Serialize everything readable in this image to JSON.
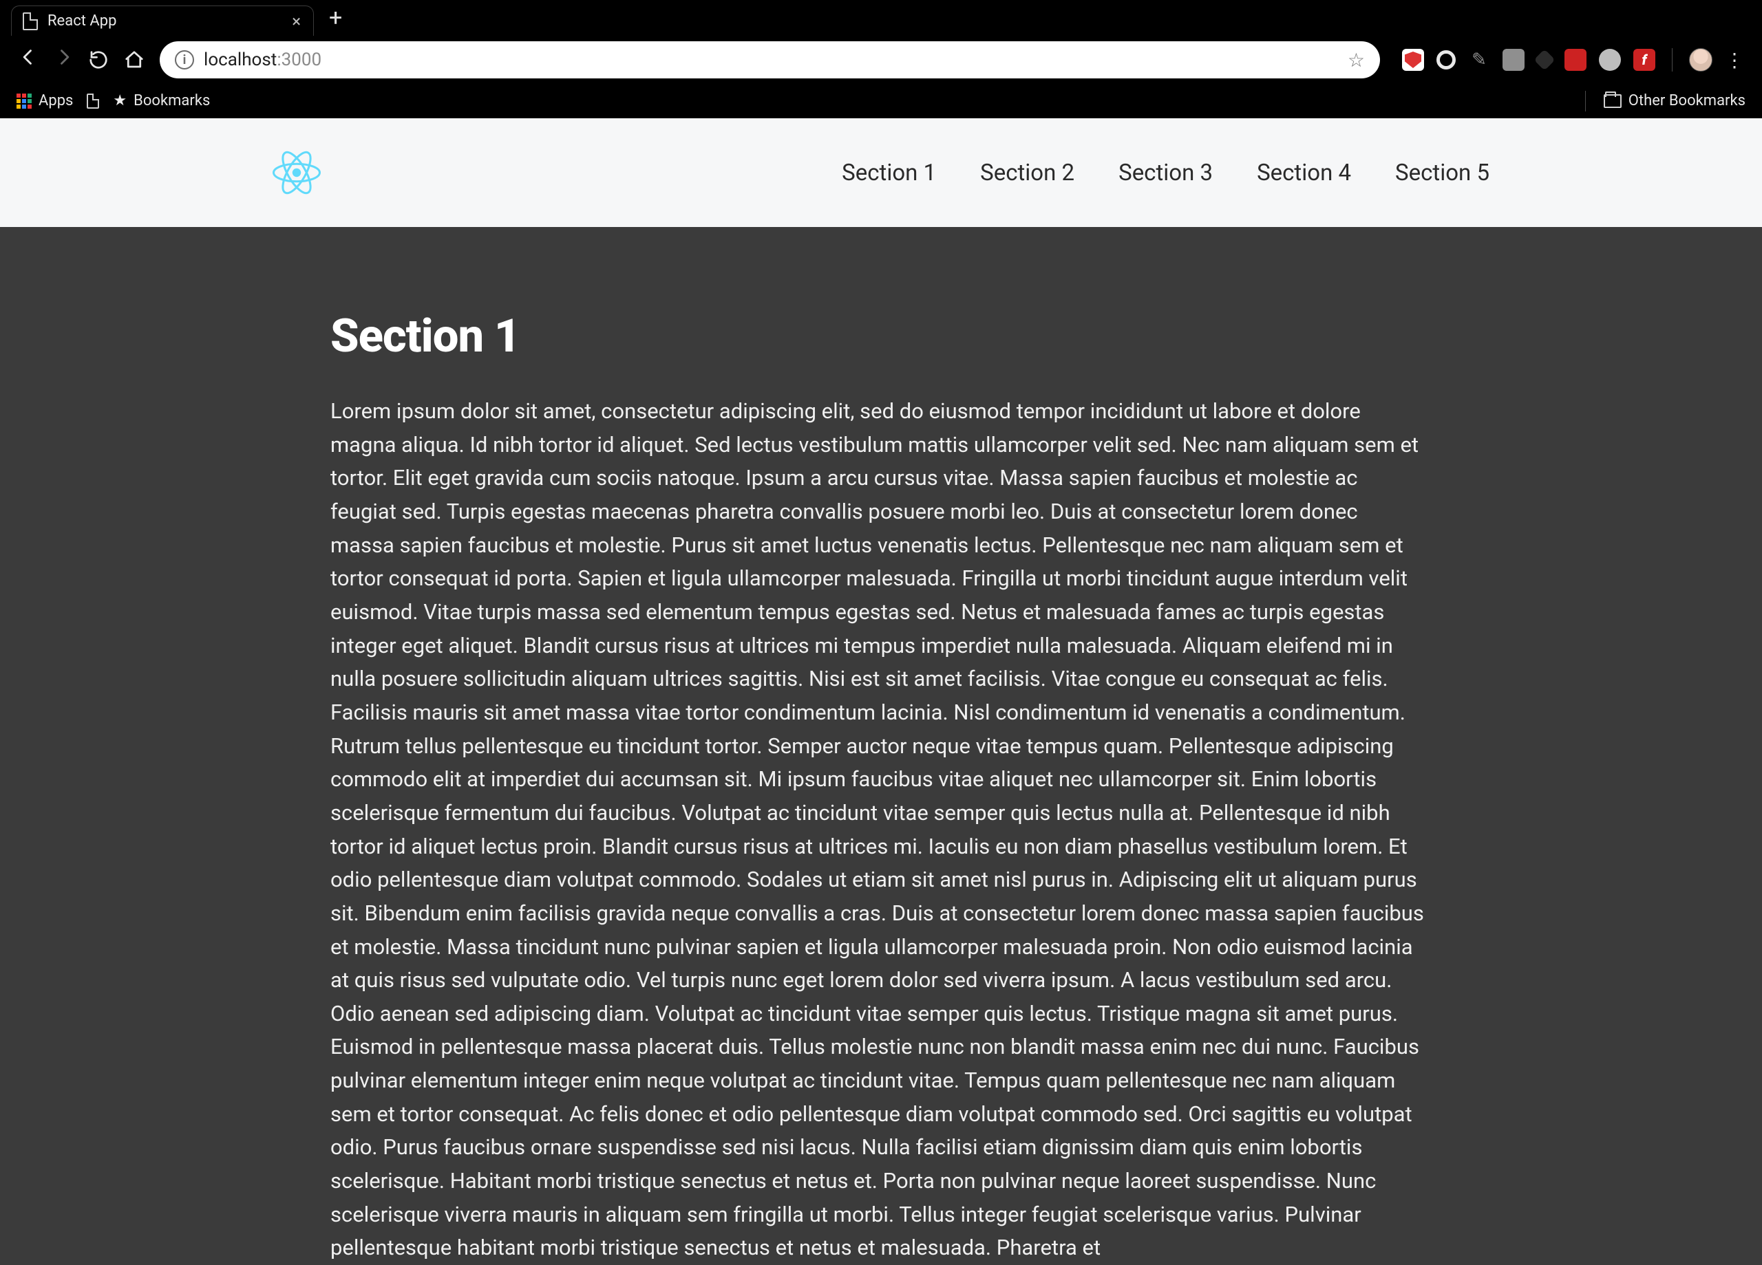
{
  "browser": {
    "tab_title": "React App",
    "url_host": "localhost",
    "url_port": ":3000",
    "apps_label": "Apps",
    "bookmarks_label": "Bookmarks",
    "other_bookmarks_label": "Other Bookmarks"
  },
  "nav": {
    "items": [
      {
        "label": "Section 1"
      },
      {
        "label": "Section 2"
      },
      {
        "label": "Section 3"
      },
      {
        "label": "Section 4"
      },
      {
        "label": "Section 5"
      }
    ]
  },
  "section": {
    "heading": "Section 1",
    "body": "Lorem ipsum dolor sit amet, consectetur adipiscing elit, sed do eiusmod tempor incididunt ut labore et dolore magna aliqua. Id nibh tortor id aliquet. Sed lectus vestibulum mattis ullamcorper velit sed. Nec nam aliquam sem et tortor. Elit eget gravida cum sociis natoque. Ipsum a arcu cursus vitae. Massa sapien faucibus et molestie ac feugiat sed. Turpis egestas maecenas pharetra convallis posuere morbi leo. Duis at consectetur lorem donec massa sapien faucibus et molestie. Purus sit amet luctus venenatis lectus. Pellentesque nec nam aliquam sem et tortor consequat id porta. Sapien et ligula ullamcorper malesuada. Fringilla ut morbi tincidunt augue interdum velit euismod. Vitae turpis massa sed elementum tempus egestas sed. Netus et malesuada fames ac turpis egestas integer eget aliquet. Blandit cursus risus at ultrices mi tempus imperdiet nulla malesuada. Aliquam eleifend mi in nulla posuere sollicitudin aliquam ultrices sagittis. Nisi est sit amet facilisis. Vitae congue eu consequat ac felis. Facilisis mauris sit amet massa vitae tortor condimentum lacinia. Nisl condimentum id venenatis a condimentum. Rutrum tellus pellentesque eu tincidunt tortor. Semper auctor neque vitae tempus quam. Pellentesque adipiscing commodo elit at imperdiet dui accumsan sit. Mi ipsum faucibus vitae aliquet nec ullamcorper sit. Enim lobortis scelerisque fermentum dui faucibus. Volutpat ac tincidunt vitae semper quis lectus nulla at. Pellentesque id nibh tortor id aliquet lectus proin. Blandit cursus risus at ultrices mi. Iaculis eu non diam phasellus vestibulum lorem. Et odio pellentesque diam volutpat commodo. Sodales ut etiam sit amet nisl purus in. Adipiscing elit ut aliquam purus sit. Bibendum enim facilisis gravida neque convallis a cras. Duis at consectetur lorem donec massa sapien faucibus et molestie. Massa tincidunt nunc pulvinar sapien et ligula ullamcorper malesuada proin. Non odio euismod lacinia at quis risus sed vulputate odio. Vel turpis nunc eget lorem dolor sed viverra ipsum. A lacus vestibulum sed arcu. Odio aenean sed adipiscing diam. Volutpat ac tincidunt vitae semper quis lectus. Tristique magna sit amet purus. Euismod in pellentesque massa placerat duis. Tellus molestie nunc non blandit massa enim nec dui nunc. Faucibus pulvinar elementum integer enim neque volutpat ac tincidunt vitae. Tempus quam pellentesque nec nam aliquam sem et tortor consequat. Ac felis donec et odio pellentesque diam volutpat commodo sed. Orci sagittis eu volutpat odio. Purus faucibus ornare suspendisse sed nisi lacus. Nulla facilisi etiam dignissim diam quis enim lobortis scelerisque. Habitant morbi tristique senectus et netus et. Porta non pulvinar neque laoreet suspendisse. Nunc scelerisque viverra mauris in aliquam sem fringilla ut morbi. Tellus integer feugiat scelerisque varius. Pulvinar pellentesque habitant morbi tristique senectus et netus et malesuada. Pharetra et"
  }
}
